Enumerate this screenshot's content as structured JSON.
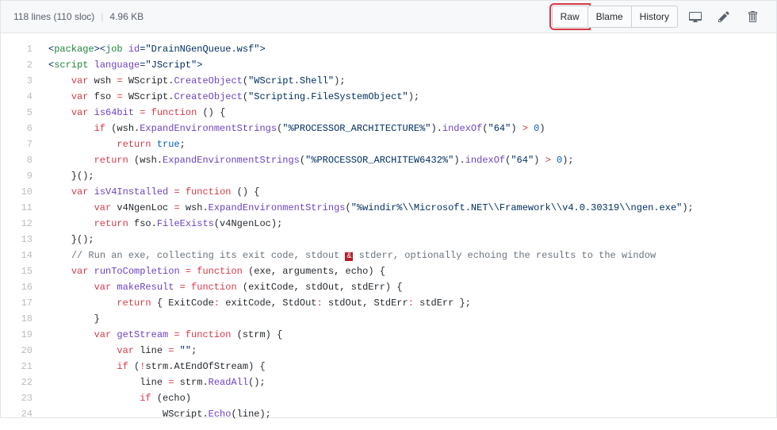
{
  "header": {
    "lines": "118 lines (110 sloc)",
    "size": "4.96 KB",
    "raw": "Raw",
    "blame": "Blame",
    "history": "History"
  },
  "code": {
    "lines": [
      {
        "n": 1,
        "html": "<span class='pl-s'>&lt;<span class='pl-ent'>package</span>&gt;&lt;<span class='pl-ent'>job</span> <span class='pl-e'>id</span>=<span class='pl-pds'>\"DrainNGenQueue.wsf\"</span>&gt;</span>"
      },
      {
        "n": 2,
        "html": "<span class='pl-s'>&lt;<span class='pl-ent'>script</span> <span class='pl-e'>language</span>=<span class='pl-pds'>\"JScript\"</span>&gt;</span>"
      },
      {
        "n": 3,
        "html": "    <span class='pl-k'>var</span> wsh <span class='pl-k'>=</span> <span class='pl-smi'>WScript</span>.<span class='pl-en'>CreateObject</span>(<span class='pl-s'>\"WScript.Shell\"</span>);"
      },
      {
        "n": 4,
        "html": "    <span class='pl-k'>var</span> fso <span class='pl-k'>=</span> <span class='pl-smi'>WScript</span>.<span class='pl-en'>CreateObject</span>(<span class='pl-s'>\"Scripting.FileSystemObject\"</span>);"
      },
      {
        "n": 5,
        "html": "    <span class='pl-k'>var</span> <span class='pl-en'>is64bit</span> <span class='pl-k'>=</span> <span class='pl-k'>function</span> () {"
      },
      {
        "n": 6,
        "html": "        <span class='pl-k'>if</span> (<span class='pl-smi'>wsh</span>.<span class='pl-en'>ExpandEnvironmentStrings</span>(<span class='pl-s'>\"%PROCESSOR_ARCHITECTURE%\"</span>).<span class='pl-en'>indexOf</span>(<span class='pl-s'>\"64\"</span>) <span class='pl-k'>&gt;</span> <span class='pl-c1'>0</span>)"
      },
      {
        "n": 7,
        "html": "            <span class='pl-k'>return</span> <span class='pl-c1'>true</span>;"
      },
      {
        "n": 8,
        "html": "        <span class='pl-k'>return</span> (<span class='pl-smi'>wsh</span>.<span class='pl-en'>ExpandEnvironmentStrings</span>(<span class='pl-s'>\"%PROCESSOR_ARCHITEW6432%\"</span>).<span class='pl-en'>indexOf</span>(<span class='pl-s'>\"64\"</span>) <span class='pl-k'>&gt;</span> <span class='pl-c1'>0</span>);"
      },
      {
        "n": 9,
        "html": "    }();"
      },
      {
        "n": 10,
        "html": "    <span class='pl-k'>var</span> <span class='pl-en'>isV4Installed</span> <span class='pl-k'>=</span> <span class='pl-k'>function</span> () {"
      },
      {
        "n": 11,
        "html": "        <span class='pl-k'>var</span> v4NgenLoc <span class='pl-k'>=</span> <span class='pl-smi'>wsh</span>.<span class='pl-en'>ExpandEnvironmentStrings</span>(<span class='pl-s'>\"%windir%\\\\Microsoft.NET\\\\Framework\\\\v4.0.30319\\\\ngen.exe\"</span>);"
      },
      {
        "n": 12,
        "html": "        <span class='pl-k'>return</span> <span class='pl-smi'>fso</span>.<span class='pl-en'>FileExists</span>(v4NgenLoc);"
      },
      {
        "n": 13,
        "html": "    }();"
      },
      {
        "n": 14,
        "html": "    <span class='pl-c'>// Run an exe, collecting its exit code, stdout <span class='amp'>&amp;</span> stderr, optionally echoing the results to the window</span>"
      },
      {
        "n": 15,
        "html": "    <span class='pl-k'>var</span> <span class='pl-en'>runToCompletion</span> <span class='pl-k'>=</span> <span class='pl-k'>function</span> (<span class='pl-smi'>exe</span>, <span class='pl-smi'>arguments</span>, <span class='pl-smi'>echo</span>) {"
      },
      {
        "n": 16,
        "html": "        <span class='pl-k'>var</span> <span class='pl-en'>makeResult</span> <span class='pl-k'>=</span> <span class='pl-k'>function</span> (<span class='pl-smi'>exitCode</span>, <span class='pl-smi'>stdOut</span>, <span class='pl-smi'>stdErr</span>) {"
      },
      {
        "n": 17,
        "html": "            <span class='pl-k'>return</span> { ExitCode<span class='pl-k'>:</span> exitCode, StdOut<span class='pl-k'>:</span> stdOut, StdErr<span class='pl-k'>:</span> stdErr };"
      },
      {
        "n": 18,
        "html": "        }"
      },
      {
        "n": 19,
        "html": "        <span class='pl-k'>var</span> <span class='pl-en'>getStream</span> <span class='pl-k'>=</span> <span class='pl-k'>function</span> (<span class='pl-smi'>strm</span>) {"
      },
      {
        "n": 20,
        "html": "            <span class='pl-k'>var</span> line <span class='pl-k'>=</span> <span class='pl-s'>\"\"</span>;"
      },
      {
        "n": 21,
        "html": "            <span class='pl-k'>if</span> (<span class='pl-k'>!</span><span class='pl-smi'>strm</span>.<span class='pl-smi'>AtEndOfStream</span>) {"
      },
      {
        "n": 22,
        "html": "                line <span class='pl-k'>=</span> <span class='pl-smi'>strm</span>.<span class='pl-en'>ReadAll</span>();"
      },
      {
        "n": 23,
        "html": "                <span class='pl-k'>if</span> (echo)"
      },
      {
        "n": 24,
        "html": "                    <span class='pl-smi'>WScript</span>.<span class='pl-en'>Echo</span>(line);"
      }
    ]
  }
}
